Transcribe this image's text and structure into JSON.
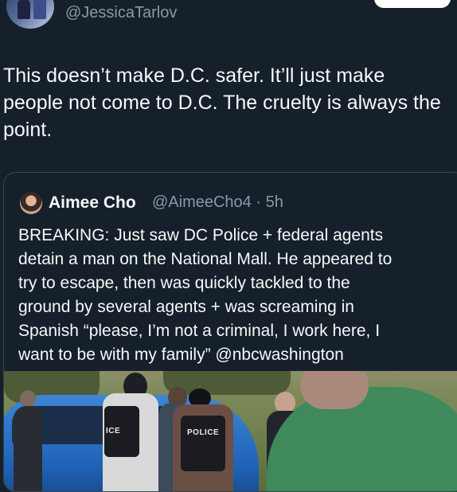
{
  "tweet": {
    "handle": "@JessicaTarlov",
    "text": "This doesn’t make D.C. safer. It’ll just make\npeople not come to D.C. The cruelty is always the\npoint."
  },
  "quoted": {
    "name": "Aimee Cho",
    "meta": "@AimeeCho4 · 5h",
    "text": "BREAKING: Just saw DC Police + federal agents\ndetain a man on the National Mall. He appeared to\ntry to escape, then was quickly tackled to the\nground by several agents + was screaming in\nSpanish “please, I’m not a criminal, I work here, I\nwant to be with my family” @nbcwashington",
    "media": {
      "vest_label_1": "ICE",
      "vest_label_2": "POLICE"
    }
  },
  "colors": {
    "background": "#15202b",
    "text_primary": "#f7f9f9",
    "text_secondary": "#8b98a5",
    "border": "#38444d"
  }
}
